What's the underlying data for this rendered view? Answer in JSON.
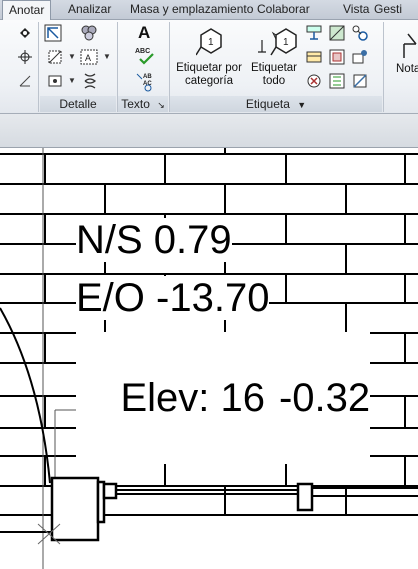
{
  "tabs": [
    {
      "label": "Anotar",
      "active": true
    },
    {
      "label": "Analizar",
      "active": false
    },
    {
      "label": "Masa y emplazamiento",
      "active": false
    },
    {
      "label": "Colaborar",
      "active": false
    },
    {
      "label": "Vista",
      "active": false
    },
    {
      "label": "Gesti",
      "active": false
    }
  ],
  "ribbon": {
    "panels": {
      "detalle": "Detalle",
      "texto": "Texto",
      "etiqueta": "Etiqueta"
    },
    "buttons": {
      "tag_by_category": "Etiquetar por\ncategoría",
      "tag_all": "Etiquetar\ntodo",
      "note": "Nota",
      "text_icon_letter": "A",
      "spell_abc": "ABC",
      "find_replace_abc": "AB AC"
    },
    "text_launcher": "↘",
    "etiqueta_dropdown": "▼"
  },
  "canvas": {
    "spot_coordinate": {
      "ns": "N/S 0.79",
      "ew": "E/O -13.70",
      "elev_a": "Elev: 16",
      "elev_b": "-0.32"
    }
  },
  "colors": {
    "accent": "#3a6ea5",
    "ribbon_bg": "#eef1f5"
  }
}
